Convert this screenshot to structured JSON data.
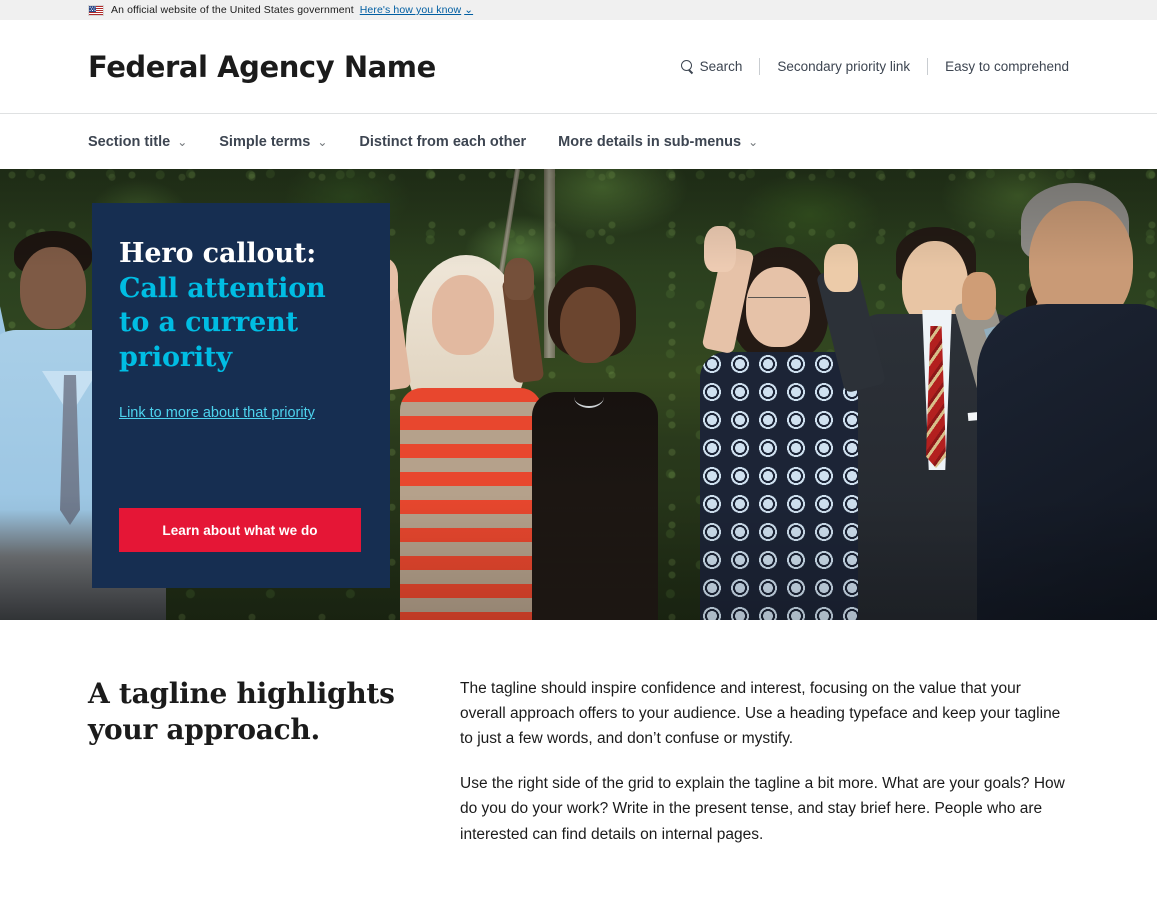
{
  "banner": {
    "flag_icon": "us-flag-icon",
    "text": "An official website of the United States government",
    "link_label": "Here's how you know",
    "chevron": "⌄",
    "background": "#f0f0f0",
    "link_color": "#005ea2"
  },
  "header": {
    "agency_name": "Federal Agency Name",
    "secondary_nav": [
      {
        "label": "Search",
        "icon": "search-icon"
      },
      {
        "label": "Secondary priority link",
        "icon": ""
      },
      {
        "label": "Easy to comprehend",
        "icon": ""
      }
    ]
  },
  "primary_nav": {
    "items": [
      {
        "label": "Section title",
        "has_submenu": true,
        "chevron": "⌄"
      },
      {
        "label": "Simple terms",
        "has_submenu": true,
        "chevron": "⌄"
      },
      {
        "label": "Distinct from each other",
        "has_submenu": false,
        "chevron": ""
      },
      {
        "label": "More details in sub-menus",
        "has_submenu": true,
        "chevron": "⌄"
      }
    ]
  },
  "hero": {
    "heading_lead": "Hero callout:",
    "heading_accent_line1": "Call attention",
    "heading_accent_line2": "to a current",
    "heading_accent_line3": "priority",
    "link_label": "Link to more about that priority",
    "button_label": "Learn about what we do",
    "box_color": "#162e51",
    "accent_color": "#00bde3",
    "link_color": "#4dd3ee",
    "button_color": "#e51636",
    "image_description": "Group of people with right hands raised taking the oath of citizenship outdoors in front of trees"
  },
  "tagline_section": {
    "tagline_line1": "A tagline highlights",
    "tagline_line2": "your approach.",
    "paragraphs": [
      "The tagline should inspire confidence and interest, focusing on the value that your overall approach offers to your audience. Use a heading typeface and keep your tagline to just a few words, and don’t confuse or mystify.",
      "Use the right side of the grid to explain the tagline a bit more. What are your goals? How do you do your work? Write in the present tense, and stay brief here. People who are interested can find details on internal pages."
    ]
  }
}
